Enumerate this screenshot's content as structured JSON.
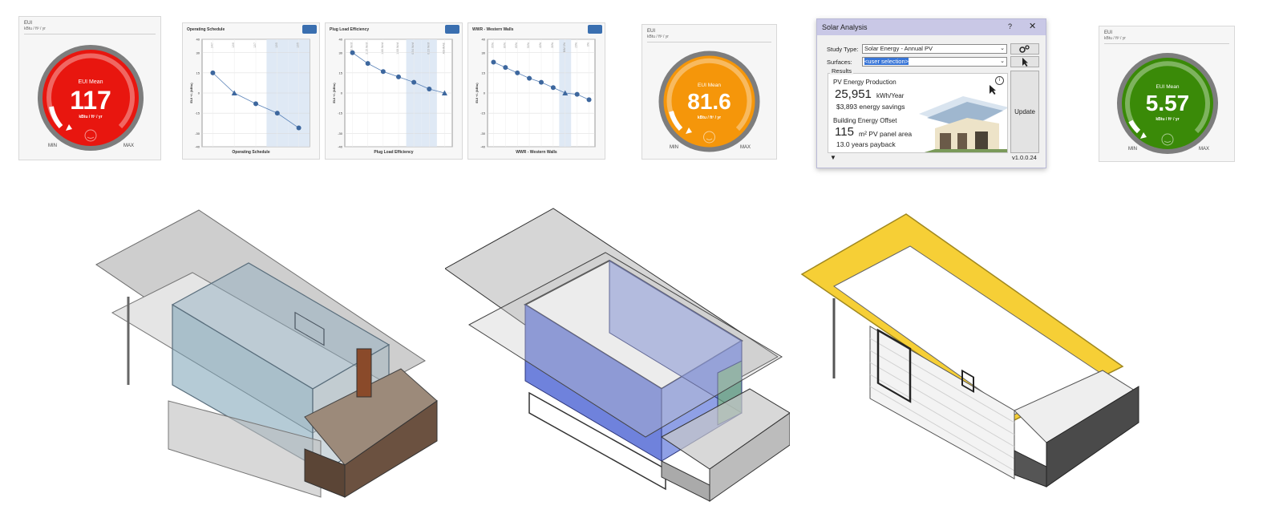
{
  "eui_dials": [
    {
      "title": "EUI",
      "unit": "kBtu / ft² / yr",
      "label": "EUI Mean",
      "value": "117",
      "value_unit": "kBtu / ft² / yr",
      "min_label": "MIN",
      "max_label": "MAX",
      "color": "#e8160f",
      "level": 0.72
    },
    {
      "title": "EUI",
      "unit": "kBtu / ft² / yr",
      "label": "EUI Mean",
      "value": "81.6",
      "value_unit": "kBtu / ft² / yr",
      "min_label": "MIN",
      "max_label": "MAX",
      "color": "#f5960a",
      "level": 0.82
    },
    {
      "title": "EUI",
      "unit": "kBtu / ft² / yr",
      "label": "EUI Mean",
      "value": "5.57",
      "value_unit": "kBtu / ft² / yr",
      "min_label": "MIN",
      "max_label": "MAX",
      "color": "#3a8a08",
      "level": 0.92
    }
  ],
  "chart_data": [
    {
      "type": "line",
      "title": "Operating Schedule",
      "xlabel": "Operating Schedule",
      "ylabel": "EUI +/- (kBtu)",
      "yticks": [
        40,
        30,
        15,
        0,
        -15,
        -30,
        -40
      ],
      "categories": [
        "24/7",
        "12/6",
        "12/7",
        "12/5",
        "12/5"
      ],
      "values": [
        15,
        0,
        -8,
        -15,
        -26
      ],
      "current_index": 1,
      "highlight": [
        3,
        4
      ]
    },
    {
      "type": "line",
      "title": "Plug Load Efficiency",
      "xlabel": "Plug Load Efficiency",
      "ylabel": "EUI +/- (kBtu)",
      "yticks": [
        40,
        30,
        15,
        0,
        -15,
        -30,
        -40
      ],
      "categories": [
        "0.66 W/sf",
        "2.15 W/sf",
        "1.60 W/sf",
        "1.08 W/sf",
        "0.54 W/sf",
        "0.23 W/sf",
        "ASHRAE"
      ],
      "values": [
        30,
        22,
        16,
        12,
        8,
        3,
        0
      ],
      "current_index": 6,
      "highlight": [
        4,
        5
      ]
    },
    {
      "type": "line",
      "title": "WWR - Western Walls",
      "xlabel": "WWR - Western Walls",
      "ylabel": "EUI +/- (kBtu)",
      "yticks": [
        40,
        30,
        15,
        0,
        -15,
        -30,
        -40
      ],
      "categories": [
        "95%",
        "80%",
        "65%",
        "50%",
        "40%",
        "30%",
        "BIM 0%",
        "15%",
        "0%"
      ],
      "values": [
        23,
        19,
        15,
        11,
        8,
        4,
        0,
        -1,
        -5
      ],
      "current_index": 6,
      "highlight": [
        6
      ]
    }
  ],
  "solar": {
    "title": "Solar Analysis",
    "help": "?",
    "close": "✕",
    "study_type_label": "Study Type:",
    "study_type_value": "Solar Energy - Annual PV",
    "surfaces_label": "Surfaces:",
    "surfaces_value": "<user selection>",
    "results_label": "Results",
    "pv_heading": "PV Energy Production",
    "pv_value": "25,951",
    "pv_unit": "kWh/Year",
    "savings": "$3,893 energy savings",
    "offset_heading": "Building Energy Offset",
    "area_value": "115",
    "area_unit": "m² PV panel area",
    "payback": "13.0 years payback",
    "update_label": "Update",
    "version": "v1.0.0.24",
    "info_icon": "info-icon",
    "settings_icon": "gear-icon",
    "pick_icon": "cursor-icon",
    "expand_icon": "triangle-down-icon"
  },
  "colors": {
    "roof_yellow": "#f6cf36",
    "glass_blue": "#6a7fd8",
    "wall_gray": "#b8b8b8",
    "wood": "#6b5140"
  }
}
